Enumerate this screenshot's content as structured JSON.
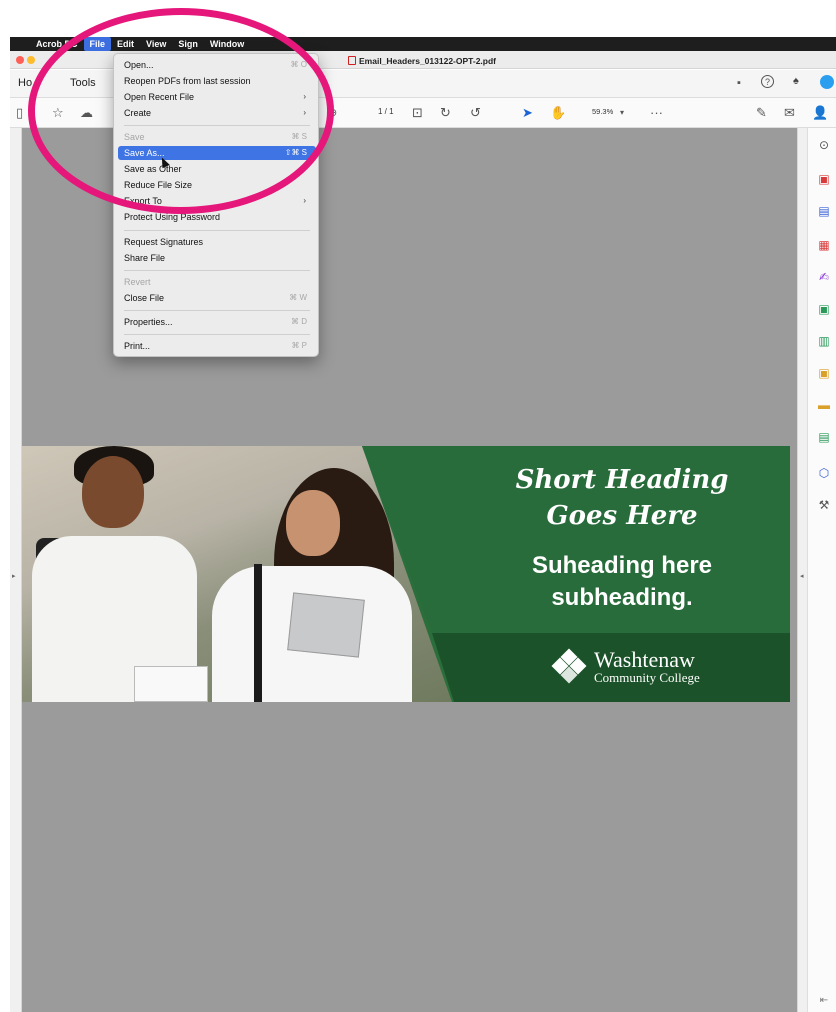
{
  "menubar": {
    "app": "Acrobat Pro DC",
    "app_visible": "Acrob      DC",
    "items": [
      "File",
      "Edit",
      "View",
      "Sign",
      "Window"
    ]
  },
  "document": {
    "tab_title": "Email_Headers_013122-OPT-2.pdf"
  },
  "tabs": {
    "home": "Home",
    "home_visible": "Ho  e",
    "tools": "Tools"
  },
  "toolbar": {
    "page_indicator": "1  / 1",
    "zoom": "59.3%",
    "more": "···"
  },
  "file_menu": {
    "items": [
      {
        "label": "Open...",
        "shortcut": "⌘ O",
        "enabled": true
      },
      {
        "label": "Reopen PDFs from last session",
        "shortcut": "",
        "enabled": true
      },
      {
        "label": "Open Recent File",
        "shortcut": "",
        "submenu": true,
        "enabled": true
      },
      {
        "label": "Create",
        "shortcut": "",
        "submenu": true,
        "enabled": true
      },
      {
        "label": "Save",
        "shortcut": "⌘ S",
        "enabled": false
      },
      {
        "label": "Save As...",
        "shortcut": "⇧⌘ S",
        "enabled": true,
        "highlighted": true
      },
      {
        "label": "Save as Other",
        "shortcut": "",
        "submenu": true,
        "enabled": true
      },
      {
        "label": "Reduce File Size",
        "shortcut": "",
        "enabled": true
      },
      {
        "label": "Export To",
        "shortcut": "",
        "submenu": true,
        "enabled": true
      },
      {
        "label": "Protect Using Password",
        "shortcut": "",
        "enabled": true
      },
      {
        "label": "Request Signatures",
        "shortcut": "",
        "enabled": true
      },
      {
        "label": "Share File",
        "shortcut": "",
        "enabled": true
      },
      {
        "label": "Revert",
        "shortcut": "",
        "enabled": false
      },
      {
        "label": "Close File",
        "shortcut": "⌘ W",
        "enabled": true
      },
      {
        "label": "Properties...",
        "shortcut": "⌘ D",
        "enabled": true
      },
      {
        "label": "Print...",
        "shortcut": "⌘ P",
        "enabled": true
      }
    ]
  },
  "banner": {
    "heading_line1": "Short Heading",
    "heading_line2": "Goes Here",
    "subheading_line1": "Suheading here",
    "subheading_line2": "subheading.",
    "logo_name": "Washtenaw",
    "logo_sub": "Community College"
  },
  "colors": {
    "highlight_ellipse": "#e5177b",
    "menu_highlight": "#3e74e3",
    "banner_green": "#276c3a",
    "banner_dark_green": "#1b5229",
    "doc_background": "#9b9b9b"
  },
  "right_panel_icons": [
    "comment-icon",
    "create-pdf-icon",
    "combine-files-icon",
    "organize-pages-icon",
    "fill-sign-icon",
    "edit-pdf-icon",
    "export-pdf-icon",
    "scan-ocr-icon",
    "comment-tool-icon",
    "print-production-icon",
    "protect-icon",
    "more-tools-icon"
  ]
}
